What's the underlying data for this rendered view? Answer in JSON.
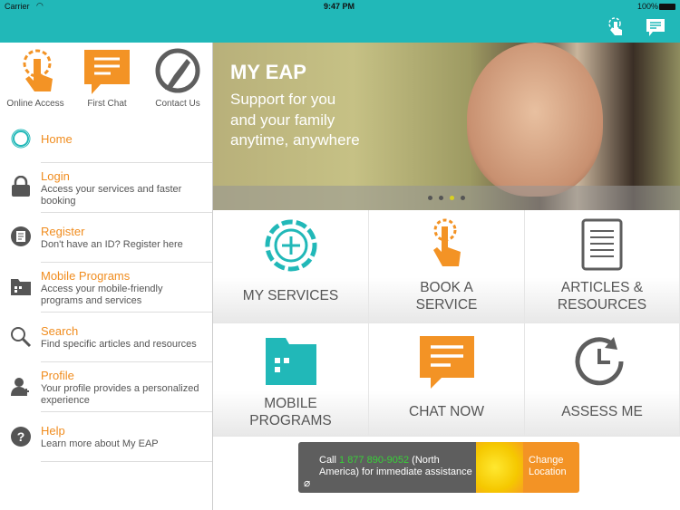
{
  "status": {
    "carrier": "Carrier",
    "time": "9:47 PM",
    "battery": "100%"
  },
  "colors": {
    "teal": "#21b8b8",
    "orange": "#f39325",
    "gray": "#5e5e5e"
  },
  "quick_actions": [
    {
      "label": "Online Access",
      "icon": "touch-icon"
    },
    {
      "label": "First Chat",
      "icon": "chat-icon"
    },
    {
      "label": "Contact Us",
      "icon": "phone-icon"
    }
  ],
  "menu": [
    {
      "title": "Home",
      "subtitle": ""
    },
    {
      "title": "Login",
      "subtitle": "Access your services and faster booking"
    },
    {
      "title": "Register",
      "subtitle": "Don't have an ID?  Register here"
    },
    {
      "title": "Mobile Programs",
      "subtitle": "Access your mobile-friendly programs and services"
    },
    {
      "title": "Search",
      "subtitle": "Find specific articles and resources"
    },
    {
      "title": "Profile",
      "subtitle": "Your profile provides a personalized experience"
    },
    {
      "title": "Help",
      "subtitle": "Learn more about My EAP"
    }
  ],
  "banner": {
    "title": "MY EAP",
    "line1": "Support for you",
    "line2": "and your family",
    "line3": "anytime, anywhere",
    "active_slide": 3,
    "slides": 4
  },
  "tiles": [
    {
      "l1": "MY SERVICES",
      "l2": ""
    },
    {
      "l1": "BOOK A",
      "l2": "SERVICE"
    },
    {
      "l1": "ARTICLES &",
      "l2": "RESOURCES"
    },
    {
      "l1": "MOBILE",
      "l2": "PROGRAMS"
    },
    {
      "l1": "CHAT NOW",
      "l2": ""
    },
    {
      "l1": "ASSESS ME",
      "l2": ""
    }
  ],
  "call": {
    "prefix": "Call ",
    "phone": "1 877 890-9052",
    "suffix": " (North America) for immediate assistance",
    "change": "Change Location"
  }
}
